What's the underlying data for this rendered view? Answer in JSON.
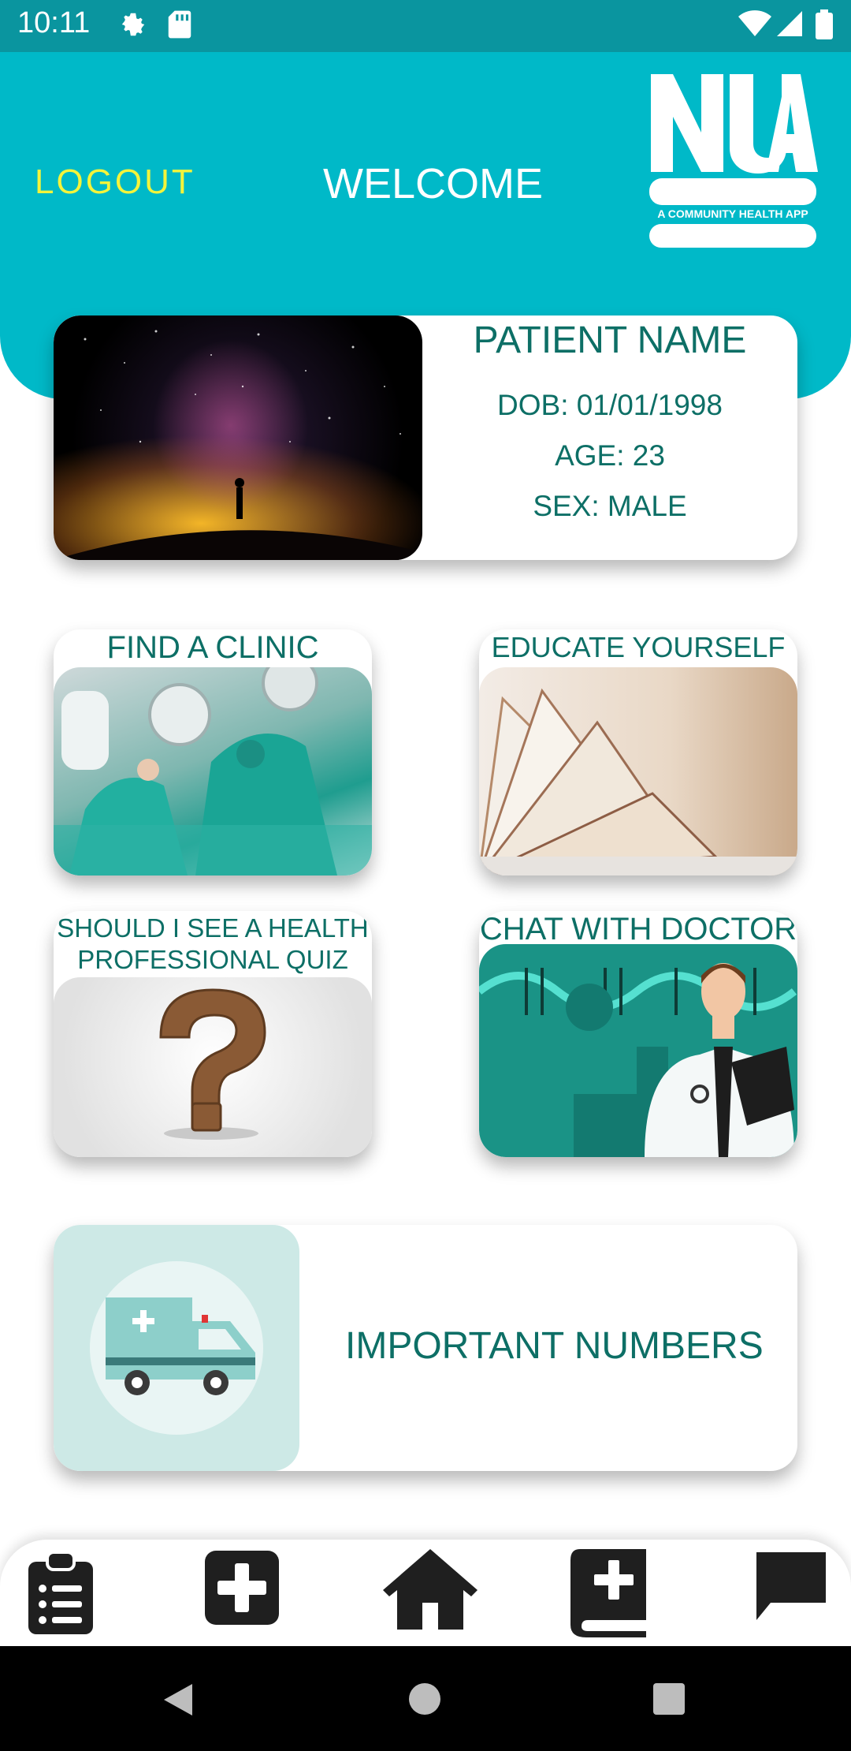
{
  "status_bar": {
    "time": "10:11"
  },
  "header": {
    "logout_label": "LOGOUT",
    "welcome_text": "WELCOME",
    "logo_text": "NUA",
    "logo_tagline": "A COMMUNITY HEALTH APP"
  },
  "patient": {
    "name": "PATIENT NAME",
    "dob": "DOB: 01/01/1998",
    "age": "AGE: 23",
    "sex": "SEX: MALE"
  },
  "tiles": [
    {
      "title": "FIND A CLINIC"
    },
    {
      "title": "EDUCATE YOURSELF"
    },
    {
      "title": "SHOULD I SEE A HEALTH PROFESSIONAL QUIZ"
    },
    {
      "title": "CHAT WITH DOCTOR"
    }
  ],
  "numbers": {
    "label": "IMPORTANT NUMBERS"
  },
  "bottom_nav": [
    "clipboard-list-icon",
    "plus-square-icon",
    "home-icon",
    "medical-book-icon",
    "chat-icon"
  ],
  "colors": {
    "teal": "#00b9c8",
    "dark_teal": "#0d6f66",
    "logout": "#f3f43b"
  }
}
